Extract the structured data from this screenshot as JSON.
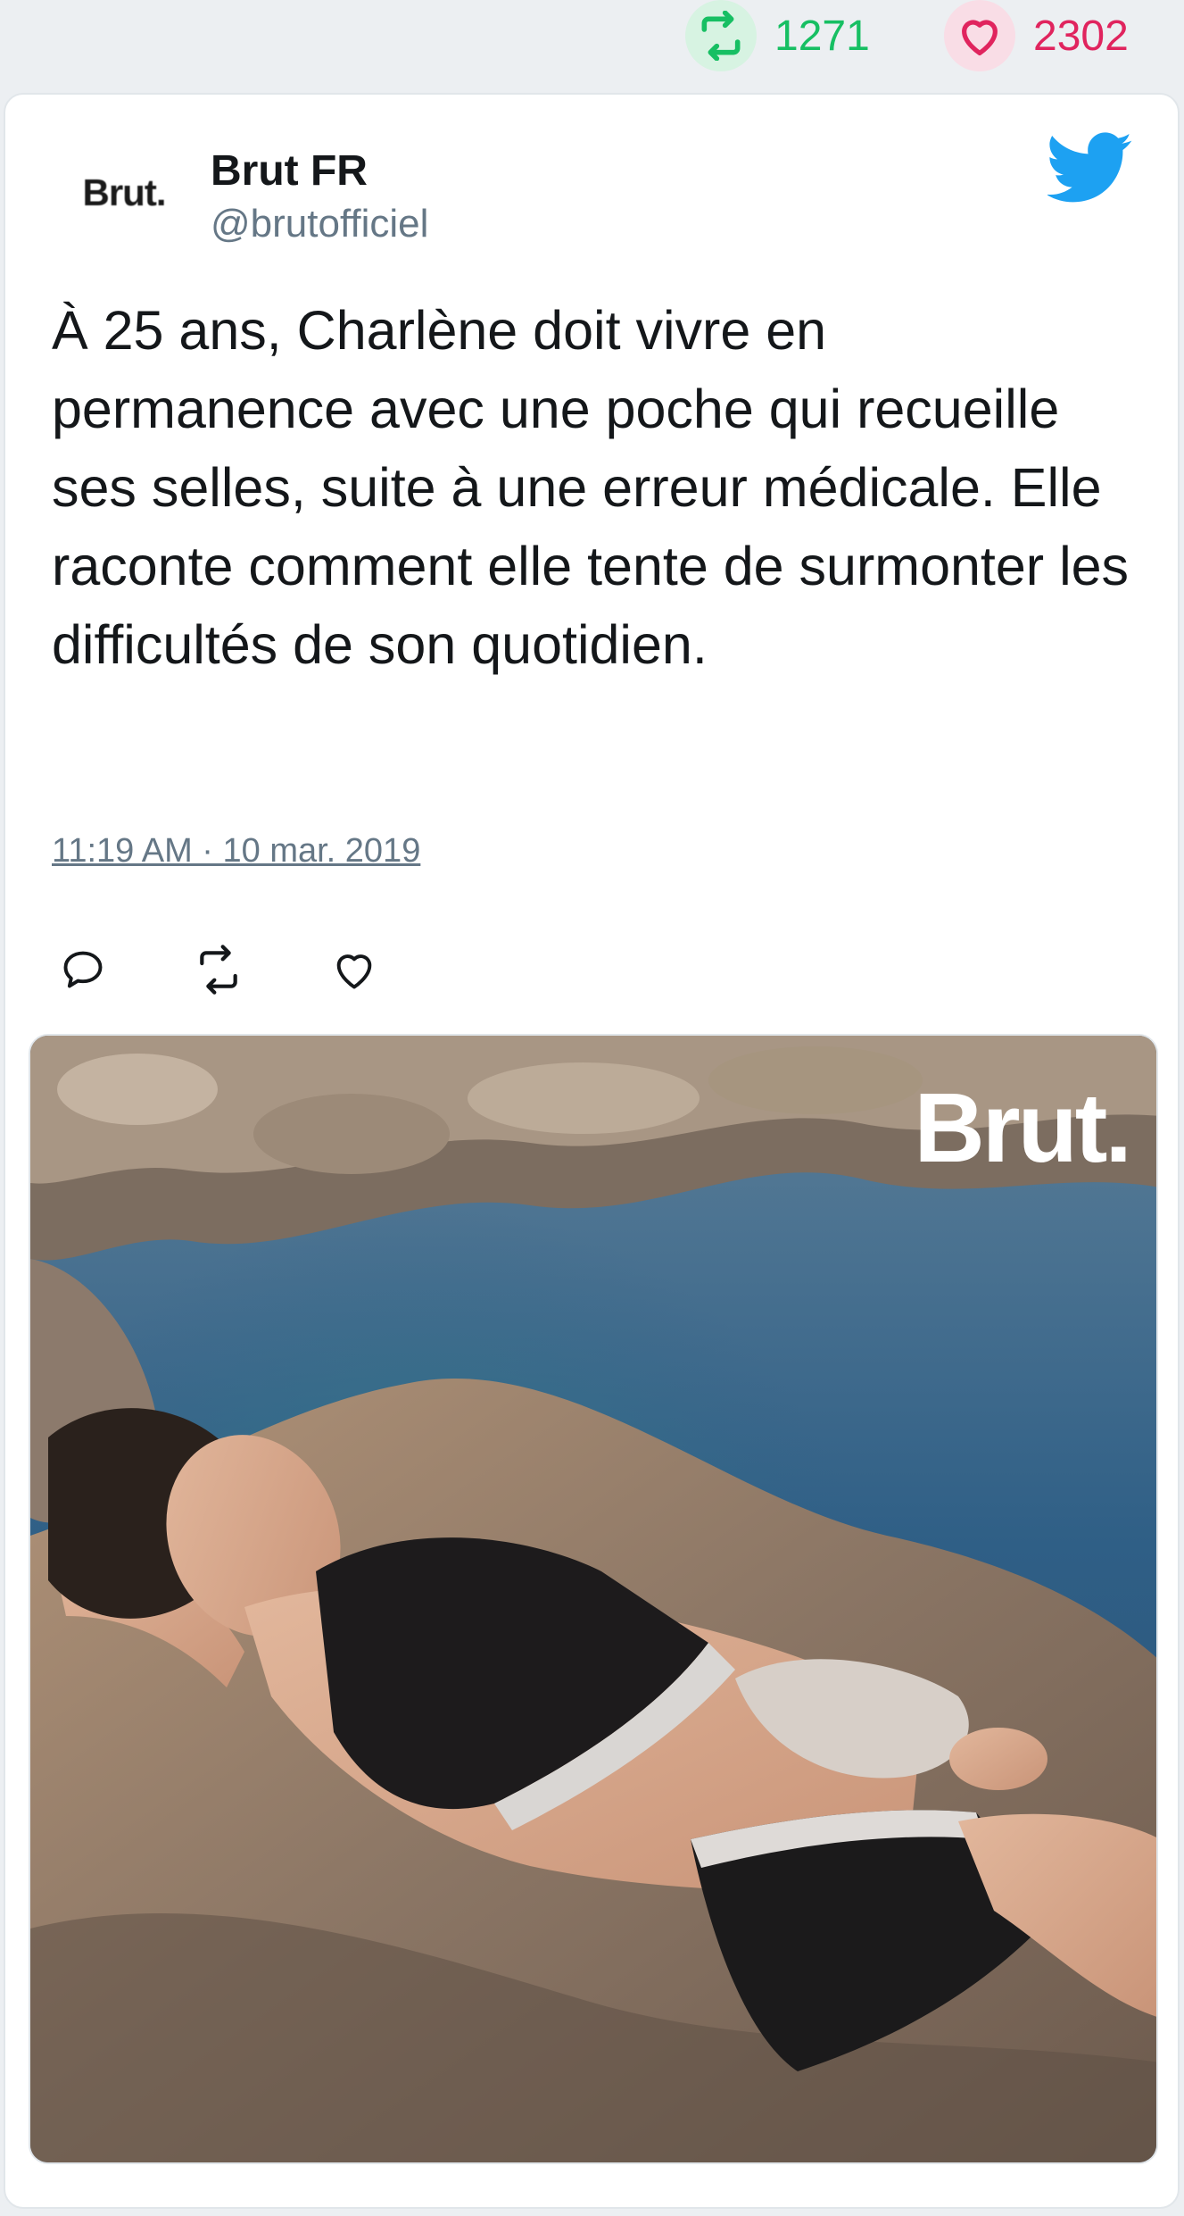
{
  "stats": {
    "retweets": "1271",
    "likes": "2302"
  },
  "tweet": {
    "avatar_text": "Brut.",
    "author_name": "Brut FR",
    "author_handle": "@brutofficiel",
    "text": "À 25 ans, Charlène doit vivre en permanence avec une poche qui recueille ses selles, suite à une erreur médicale. Elle raconte comment elle tente de surmonter les difficultés de son quotidien.",
    "timestamp": "11:19 AM · 10 mar. 2019",
    "media_brand": "Brut."
  },
  "colors": {
    "retweet_green": "#17bf63",
    "like_red": "#e0245e",
    "twitter_blue": "#1da1f2",
    "muted_text": "#657786"
  },
  "icons": [
    "retweet-icon",
    "heart-icon",
    "twitter-bird-icon",
    "reply-icon"
  ]
}
